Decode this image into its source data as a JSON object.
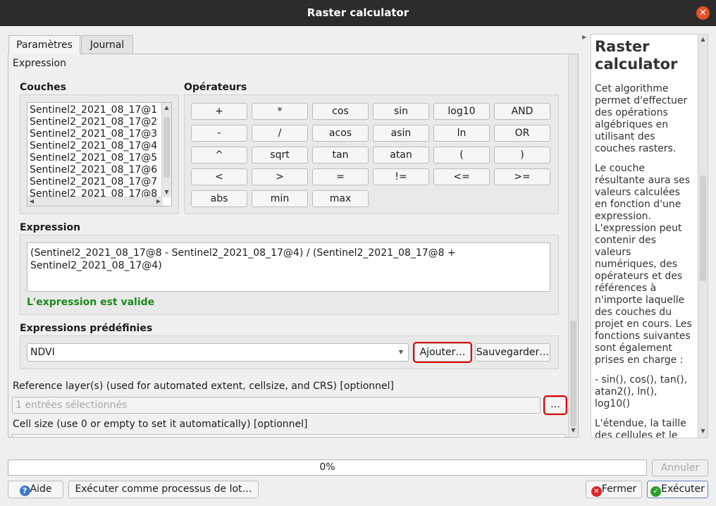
{
  "window": {
    "title": "Raster calculator",
    "close_glyph": "✕"
  },
  "tabs": [
    "Paramètres",
    "Journal"
  ],
  "section_label": "Expression",
  "layers": {
    "label": "Couches",
    "items": [
      "Sentinel2_2021_08_17@1",
      "Sentinel2_2021_08_17@2",
      "Sentinel2_2021_08_17@3",
      "Sentinel2_2021_08_17@4",
      "Sentinel2_2021_08_17@5",
      "Sentinel2_2021_08_17@6",
      "Sentinel2_2021_08_17@7",
      "Sentinel2_2021_08_17@8"
    ]
  },
  "operators": {
    "label": "Opérateurs",
    "rows": [
      [
        "+",
        "*",
        "cos",
        "sin",
        "log10",
        "AND"
      ],
      [
        "-",
        "/",
        "acos",
        "asin",
        "ln",
        "OR"
      ],
      [
        "^",
        "sqrt",
        "tan",
        "atan",
        "(",
        ")"
      ],
      [
        "<",
        ">",
        "=",
        "!=",
        "<=",
        ">="
      ],
      [
        "abs",
        "min",
        "max"
      ]
    ]
  },
  "expression": {
    "label": "Expression",
    "line1": "(Sentinel2_2021_08_17@8 - Sentinel2_2021_08_17@4) / (Sentinel2_2021_08_17@8 +",
    "line2": "Sentinel2_2021_08_17@4)",
    "status": "L'expression est valide",
    "status_color": "#1a8a1a"
  },
  "predefined": {
    "label": "Expressions prédéfinies",
    "selected": "NDVI",
    "add_button": "Ajouter…",
    "save_button": "Sauvegarder…"
  },
  "reference": {
    "label": "Reference layer(s) (used for automated extent, cellsize, and CRS) [optionnel]",
    "placeholder": "1 entrées sélectionnés",
    "browse_button": "…"
  },
  "cellsize": {
    "label": "Cell size (use 0 or empty to set it automatically) [optionnel]"
  },
  "help": {
    "title": "Raster calculator",
    "paragraphs": [
      "Cet algorithme permet d'effectuer des opérations algébriques en utilisant des couches rasters.",
      "Le couche résultante aura ses valeurs calculées en fonction d'une expression. L'expression peut contenir des valeurs numériques, des opérateurs et des références à n'importe laquelle des couches du projet en cours. Les fonctions suivantes sont également prises en charge :",
      "- sin(), cos(), tan(), atan2(), ln(), log10()",
      "L'étendue, la taille des cellules et le SRS de sortie peuvent être définis par"
    ]
  },
  "progress": {
    "text": "0%",
    "value": 0
  },
  "buttons": {
    "cancel": "Annuler",
    "help": "Aide",
    "batch": "Exécuter comme processus de lot…",
    "close": "Fermer",
    "run": "Exécuter"
  },
  "colors": {
    "highlight": "#e00000",
    "run_icon": "#2e9d2e",
    "close_icon": "#d9262b",
    "help_icon": "#3a78c9"
  }
}
